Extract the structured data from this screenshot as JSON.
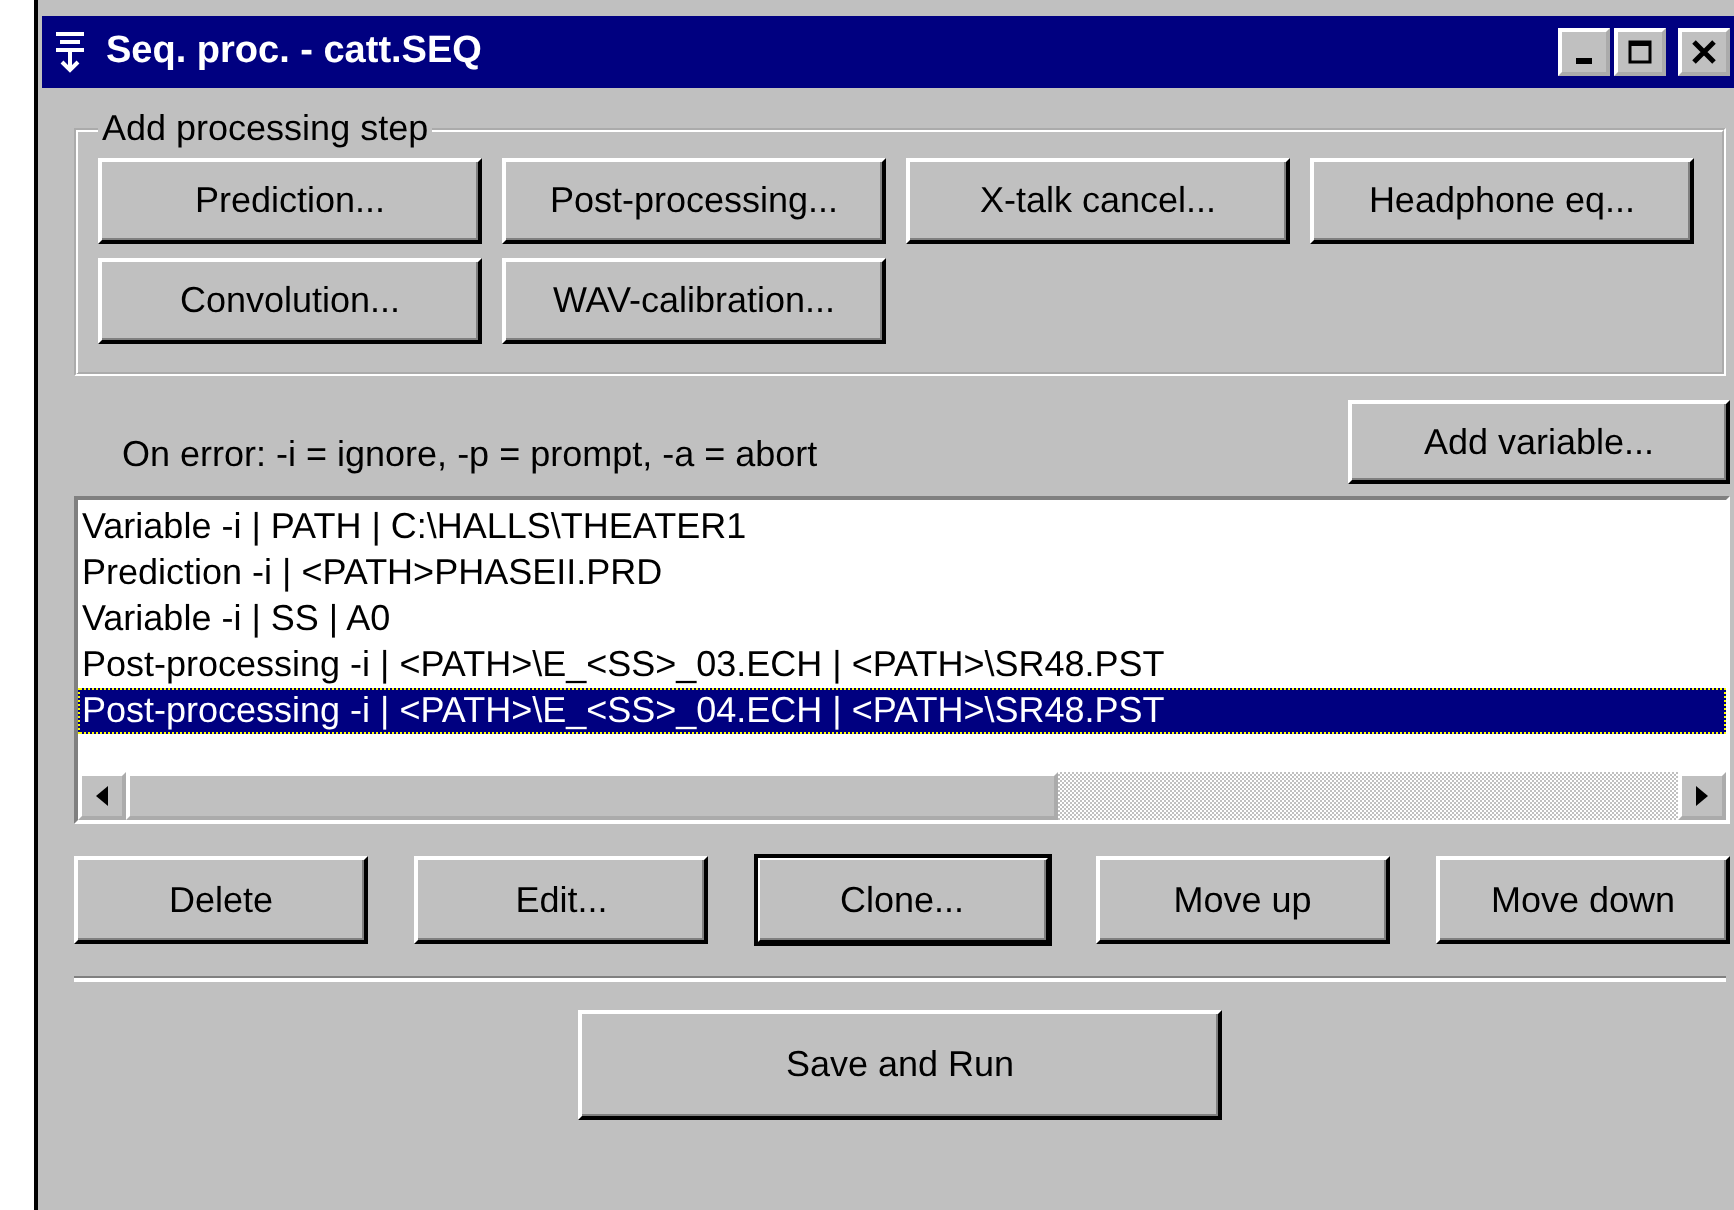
{
  "window": {
    "title": "Seq. proc. - catt.SEQ"
  },
  "add_step": {
    "legend": "Add processing step",
    "buttons": [
      "Prediction...",
      "Post-processing...",
      "X-talk cancel...",
      "Headphone eq...",
      "Convolution...",
      "WAV-calibration..."
    ]
  },
  "error_hint": "On error: -i = ignore, -p = prompt, -a = abort",
  "add_variable_button": "Add variable...",
  "steps": [
    {
      "text": "Variable -i | PATH | C:\\HALLS\\THEATER1",
      "selected": false
    },
    {
      "text": "Prediction -i | <PATH>PHASEII.PRD",
      "selected": false
    },
    {
      "text": "Variable -i | SS | A0",
      "selected": false
    },
    {
      "text": "Post-processing -i | <PATH>\\E_<SS>_03.ECH | <PATH>\\SR48.PST",
      "selected": false
    },
    {
      "text": "Post-processing -i | <PATH>\\E_<SS>_04.ECH | <PATH>\\SR48.PST",
      "selected": true
    }
  ],
  "actions": [
    {
      "label": "Delete",
      "default": false
    },
    {
      "label": "Edit...",
      "default": false
    },
    {
      "label": "Clone...",
      "default": true
    },
    {
      "label": "Move up",
      "default": false
    },
    {
      "label": "Move down",
      "default": false
    }
  ],
  "run_button": "Save and Run"
}
